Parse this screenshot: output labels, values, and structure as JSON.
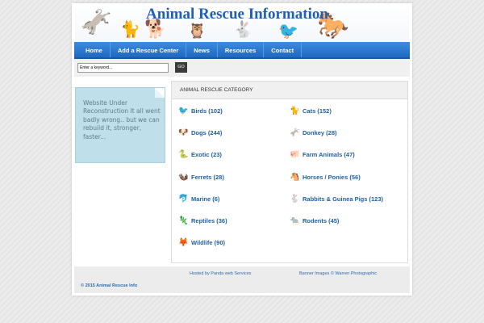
{
  "header": {
    "title": "Animal Rescue Information",
    "animals": [
      {
        "name": "donkey-icon",
        "glyph": "🫏"
      },
      {
        "name": "cat-icon",
        "glyph": "🐈"
      },
      {
        "name": "dog-icon",
        "glyph": "🐕"
      },
      {
        "name": "owl-icon",
        "glyph": "🦉"
      },
      {
        "name": "rabbit-icon",
        "glyph": "🐇"
      },
      {
        "name": "bird-icon",
        "glyph": "🐦"
      },
      {
        "name": "horse-icon",
        "glyph": "🐎"
      }
    ]
  },
  "nav": {
    "items": [
      "Home",
      "Add a Rescue Center",
      "News",
      "Resources",
      "Contact"
    ]
  },
  "search": {
    "placeholder": "Enter a keyword...",
    "value": "Enter a keyword...",
    "button_label": "GO"
  },
  "sidebar": {
    "note_text": "Website Under Reconstruction It all went badly wrong.. but we can rebuild it, stronger, faster..."
  },
  "categories": {
    "header": "ANIMAL RESCUE CATEGORY",
    "items": [
      {
        "label": "Birds (102)",
        "icon": "bird-icon",
        "glyph": "🐦",
        "color": "#2a7fd0"
      },
      {
        "label": "Cats (152)",
        "icon": "cat-icon",
        "glyph": "🐈",
        "color": "#111111"
      },
      {
        "label": "Dogs (244)",
        "icon": "dog-icon",
        "glyph": "🐶",
        "color": "#b07a3a"
      },
      {
        "label": "Donkey (28)",
        "icon": "donkey-icon",
        "glyph": "🫏",
        "color": "#6b4f33"
      },
      {
        "label": "Exotic (23)",
        "icon": "snake-icon",
        "glyph": "🐍",
        "color": "#3a9a3a"
      },
      {
        "label": "Farm Animals (47)",
        "icon": "pig-icon",
        "glyph": "🐖",
        "color": "#d84a3a"
      },
      {
        "label": "Ferrets (28)",
        "icon": "ferret-icon",
        "glyph": "🦦",
        "color": "#444444"
      },
      {
        "label": "Horses / Ponies (56)",
        "icon": "horse-icon",
        "glyph": "🐴",
        "color": "#5a3a22"
      },
      {
        "label": "Marine (6)",
        "icon": "dolphin-icon",
        "glyph": "🐬",
        "color": "#3a6a8a"
      },
      {
        "label": "Rabbits & Guinea Pigs (123)",
        "icon": "rabbit-icon",
        "glyph": "🐇",
        "color": "#6a4a9a"
      },
      {
        "label": "Reptiles (36)",
        "icon": "lizard-icon",
        "glyph": "🦎",
        "color": "#4aa020"
      },
      {
        "label": "Rodents (45)",
        "icon": "rodent-icon",
        "glyph": "🐀",
        "color": "#555555"
      },
      {
        "label": "Wildlife (90)",
        "icon": "fox-icon",
        "glyph": "🦊",
        "color": "#e06a1a"
      }
    ]
  },
  "footer": {
    "hosted_by": "Hosted by Panda web Services",
    "banner_images": "Banner Images © Warren Photographic",
    "copyright": "© 2015 Animal Rescue Info"
  }
}
